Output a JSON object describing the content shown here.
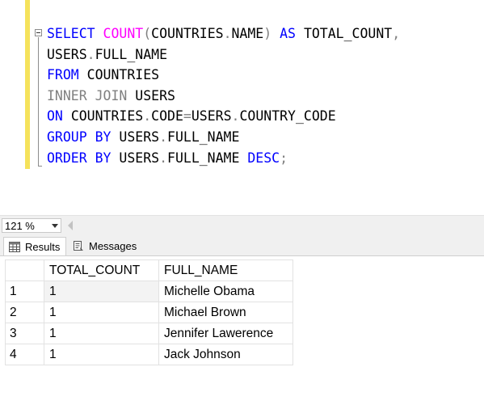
{
  "editor": {
    "lines": [
      [
        {
          "t": "SELECT ",
          "c": "kw"
        },
        {
          "t": "COUNT",
          "c": "fn"
        },
        {
          "t": "(",
          "c": "gr"
        },
        {
          "t": "COUNTRIES",
          "c": "tx"
        },
        {
          "t": ".",
          "c": "gr"
        },
        {
          "t": "NAME",
          "c": "tx"
        },
        {
          "t": ") ",
          "c": "gr"
        },
        {
          "t": "AS ",
          "c": "kw"
        },
        {
          "t": "TOTAL_COUNT",
          "c": "tx"
        },
        {
          "t": ",",
          "c": "gr"
        }
      ],
      [
        {
          "t": "USERS",
          "c": "tx"
        },
        {
          "t": ".",
          "c": "gr"
        },
        {
          "t": "FULL_NAME",
          "c": "tx"
        }
      ],
      [
        {
          "t": "FROM ",
          "c": "kw"
        },
        {
          "t": "COUNTRIES",
          "c": "tx"
        }
      ],
      [
        {
          "t": "INNER JOIN ",
          "c": "gr"
        },
        {
          "t": "USERS",
          "c": "tx"
        }
      ],
      [
        {
          "t": "ON ",
          "c": "kw"
        },
        {
          "t": "COUNTRIES",
          "c": "tx"
        },
        {
          "t": ".",
          "c": "gr"
        },
        {
          "t": "CODE",
          "c": "tx"
        },
        {
          "t": "=",
          "c": "gr"
        },
        {
          "t": "USERS",
          "c": "tx"
        },
        {
          "t": ".",
          "c": "gr"
        },
        {
          "t": "COUNTRY_CODE",
          "c": "tx"
        }
      ],
      [
        {
          "t": "GROUP BY ",
          "c": "kw"
        },
        {
          "t": "USERS",
          "c": "tx"
        },
        {
          "t": ".",
          "c": "gr"
        },
        {
          "t": "FULL_NAME",
          "c": "tx"
        }
      ],
      [
        {
          "t": "ORDER BY ",
          "c": "kw"
        },
        {
          "t": "USERS",
          "c": "tx"
        },
        {
          "t": ".",
          "c": "gr"
        },
        {
          "t": "FULL_NAME ",
          "c": "tx"
        },
        {
          "t": "DESC",
          "c": "kw"
        },
        {
          "t": ";",
          "c": "gr"
        }
      ]
    ]
  },
  "zoom": {
    "value": "121 %"
  },
  "tabs": {
    "results": "Results",
    "messages": "Messages"
  },
  "grid": {
    "columns": [
      "TOTAL_COUNT",
      "FULL_NAME"
    ],
    "rows": [
      {
        "num": "1",
        "total_count": "1",
        "full_name": "Michelle Obama"
      },
      {
        "num": "2",
        "total_count": "1",
        "full_name": "Michael Brown"
      },
      {
        "num": "3",
        "total_count": "1",
        "full_name": "Jennifer Lawerence"
      },
      {
        "num": "4",
        "total_count": "1",
        "full_name": "Jack Johnson"
      }
    ]
  },
  "colors": {
    "keyword": "#0000ff",
    "function": "#ff00ff",
    "operator": "#808080",
    "change_bar": "#f5e25b"
  },
  "icons": [
    "collapse-icon",
    "dropdown-arrow-icon",
    "scroll-left-icon",
    "results-grid-icon",
    "messages-icon"
  ]
}
